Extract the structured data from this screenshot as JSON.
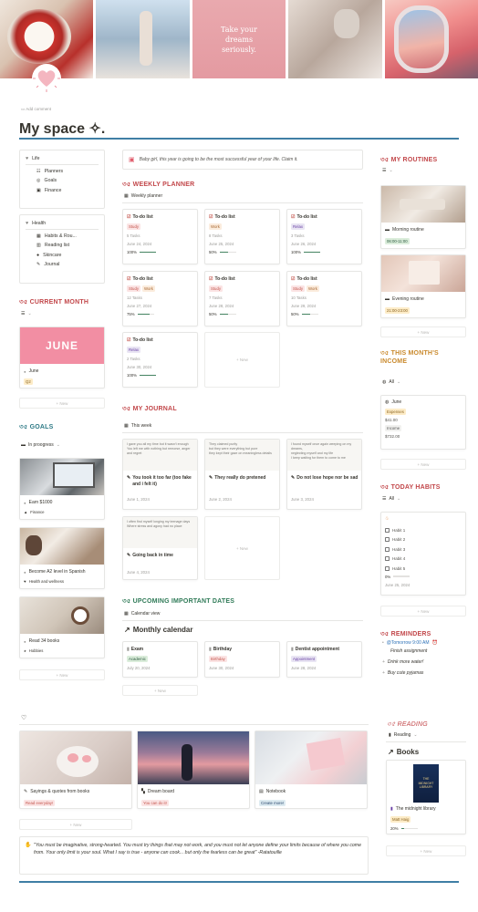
{
  "cover": {
    "quote": "Take your dreams seriously."
  },
  "page": {
    "add_comment": "Add comment",
    "title": "My space ✧."
  },
  "nav": {
    "life": {
      "label": "Life",
      "items": [
        "Planners",
        "Goals",
        "Finance"
      ]
    },
    "health": {
      "label": "Health",
      "items": [
        "Habits & Rou...",
        "Reading list",
        "Skincare",
        "Journal"
      ]
    }
  },
  "banner": {
    "text": "Baby girl, this year is going to be the most successful year of your life. Claim it."
  },
  "current_month": {
    "heading": "CURRENT MONTH",
    "cover_text": "JUNE",
    "name": "June",
    "tag": "Q2",
    "new": "+ New"
  },
  "goals": {
    "heading": "GOALS",
    "filter": "In proogress",
    "items": [
      {
        "title": "Earn $1000",
        "tag": "Finance"
      },
      {
        "title": "Become A2 level in Spanish",
        "tag": "Health and wellness"
      },
      {
        "title": "Read 34 books",
        "tag": "Hobbies"
      }
    ],
    "new": "+ New"
  },
  "weekly_planner": {
    "heading": "WEEKLY PLANNER",
    "view": "Weekly planner",
    "cards": [
      {
        "title": "To-do list",
        "tags": [
          "Study"
        ],
        "tasks": "5 Tasks",
        "date": "June 24, 2024",
        "progress": 100
      },
      {
        "title": "To-do list",
        "tags": [
          "Work"
        ],
        "tasks": "8 Tasks",
        "date": "June 25, 2024",
        "progress": 50
      },
      {
        "title": "To-do list",
        "tags": [
          "Relax"
        ],
        "tasks": "3 Tasks",
        "date": "June 26, 2024",
        "progress": 100
      },
      {
        "title": "To-do list",
        "tags": [
          "Study",
          "Work"
        ],
        "tasks": "12 Tasks",
        "date": "June 27, 2024",
        "progress": 75
      },
      {
        "title": "To-do list",
        "tags": [
          "Study"
        ],
        "tasks": "7 Tasks",
        "date": "June 28, 2024",
        "progress": 50
      },
      {
        "title": "To-do list",
        "tags": [
          "Study",
          "Work"
        ],
        "tasks": "10 Tasks",
        "date": "June 29, 2024",
        "progress": 50
      },
      {
        "title": "To-do list",
        "tags": [
          "Relax"
        ],
        "tasks": "2 Tasks",
        "date": "June 30, 2024",
        "progress": 100
      }
    ],
    "new": "+ New"
  },
  "journal": {
    "heading": "MY JOURNAL",
    "view": "This week",
    "entries": [
      {
        "preview": [
          "I gave you all my time but it wasn't enough",
          "You left me with nothing but remorse, anger and regret"
        ],
        "title": "You took it too far (too fake and i felt it)",
        "date": "June 1, 2024"
      },
      {
        "preview": [
          "They claimed purity",
          "but they were everything but pure",
          "they kept their gaze on meaningless details"
        ],
        "title": "They really do pretened",
        "date": "June 2, 2024"
      },
      {
        "preview": [
          "I found myself once again weeping on my dreams,",
          "neglecting myself and my life",
          "I keep waiting for them to come to me"
        ],
        "title": "Do not lose hope nor be sad",
        "date": "June 3, 2024"
      },
      {
        "preview": [
          "I often find myself longing my teenage days",
          "Where stress and agony had no place"
        ],
        "title": "Going back in time",
        "date": "June 4, 2024"
      }
    ],
    "new": "+ New"
  },
  "upcoming": {
    "heading": "UPCOMING IMPORTANT DATES",
    "view": "Calendar view",
    "subheading": "Monthly calendar",
    "cards": [
      {
        "title": "Exam",
        "tag": "Academic",
        "date": "July 20, 2024"
      },
      {
        "title": "Birthday",
        "tag": "Birthday",
        "date": "June 30, 2024"
      },
      {
        "title": "Dentist appointment",
        "tag": "Appointment",
        "date": "June 28, 2024"
      }
    ],
    "new": "+ New"
  },
  "routines": {
    "heading": "MY ROUTINES",
    "items": [
      {
        "title": "Morning routine",
        "time": "06:00-11:00"
      },
      {
        "title": "Evening routine",
        "time": "21:00-23:00"
      }
    ],
    "new": "+ New"
  },
  "income": {
    "heading": "THIS MONTH'S INCOME",
    "filter": "All",
    "card": {
      "title": "June",
      "expenses_label": "Expenses",
      "expenses": "$41.00",
      "income_label": "Income",
      "income": "$732.00"
    },
    "new": "+ New"
  },
  "habits": {
    "heading": "TODAY HABITS",
    "filter": "All",
    "items": [
      "Habit 1",
      "Habit 2",
      "Habit 3",
      "Habit 4",
      "Habit 5"
    ],
    "progress": "0%",
    "date": "June 25, 2024",
    "new": "+ New"
  },
  "reminders": {
    "heading": "REMINDERS",
    "items": [
      {
        "time": "@Tomorrow 9:00 AM",
        "text": "Finish assignment"
      },
      {
        "text": "Drink more water!"
      },
      {
        "text": "Buy cute pyjamas"
      }
    ]
  },
  "gallery": {
    "items": [
      {
        "title": "Sayings & quotes from books",
        "tag": "Read everyday!"
      },
      {
        "title": "Dream board",
        "tag": "You can do it!"
      },
      {
        "title": "Notebook",
        "tag": "Create more!"
      }
    ],
    "new": "+ New"
  },
  "reading": {
    "heading": "READING",
    "view": "Reading",
    "subheading": "Books",
    "book": {
      "cover_line1": "THE",
      "cover_line2": "MIDNIGHT",
      "cover_line3": "LIBRARY",
      "title": "The midnight library",
      "author": "Matt Haig",
      "progress": "20%"
    },
    "new": "+ New"
  },
  "footer_quote": "\"You must be imaginative, strong-hearted. You must try things that may not work, and you must not let anyone define your limits because of where you come from. Your only limit is your soul. What I say is true - anyone can cook... but only the fearless can be great\"  -Ratatouille",
  "colors": {
    "accent_red": "#c2474a",
    "accent_teal": "#2f7a86",
    "divider": "#3f7fa5"
  }
}
